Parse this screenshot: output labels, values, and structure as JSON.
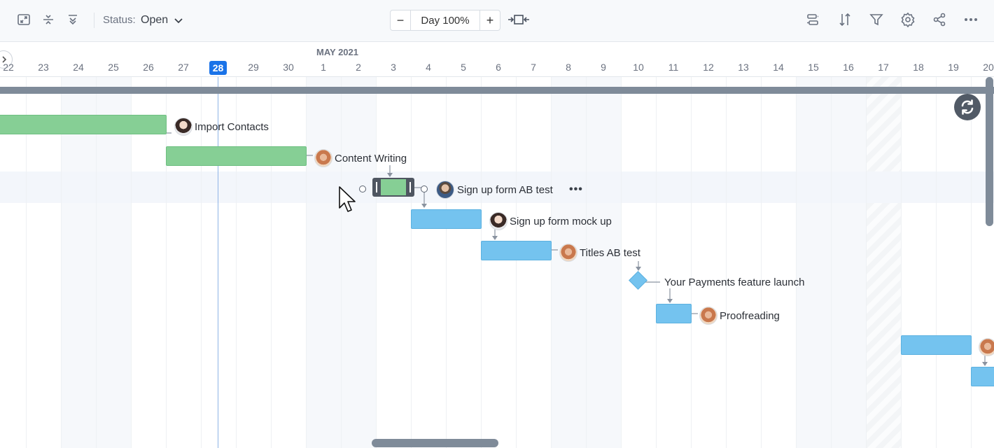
{
  "toolbar": {
    "status_label": "Status:",
    "status_value": "Open",
    "zoom_label": "Day 100%",
    "zoom_minus": "−",
    "zoom_plus": "+",
    "left_icons": [
      "fullscreen-icon",
      "collapse-icon",
      "expand-all-icon"
    ],
    "right_icons": [
      "swap-icon",
      "sort-icon",
      "filter-icon",
      "gear-icon",
      "share-icon",
      "more-icon"
    ]
  },
  "timescale": {
    "month": "MAY 2021",
    "days": [
      "22",
      "23",
      "24",
      "25",
      "26",
      "27",
      "28",
      "29",
      "30",
      "1",
      "2",
      "3",
      "4",
      "5",
      "6",
      "7",
      "8",
      "9",
      "10",
      "11",
      "12",
      "13",
      "14",
      "15",
      "16",
      "17",
      "18",
      "19",
      "20"
    ],
    "today": "28"
  },
  "tasks": [
    {
      "name": "Import Contacts"
    },
    {
      "name": "Content Writing"
    },
    {
      "name": "Sign up form AB test"
    },
    {
      "name": "Sign up form mock up"
    },
    {
      "name": "Titles AB test"
    },
    {
      "name": "Your Payments feature launch"
    },
    {
      "name": "Proofreading"
    }
  ],
  "row_menu": "•••",
  "colors": {
    "green_bar": "#86cf95",
    "blue_bar": "#74c3ef",
    "today_accent": "#1a73e8",
    "summary_bar": "#7f8b99"
  }
}
